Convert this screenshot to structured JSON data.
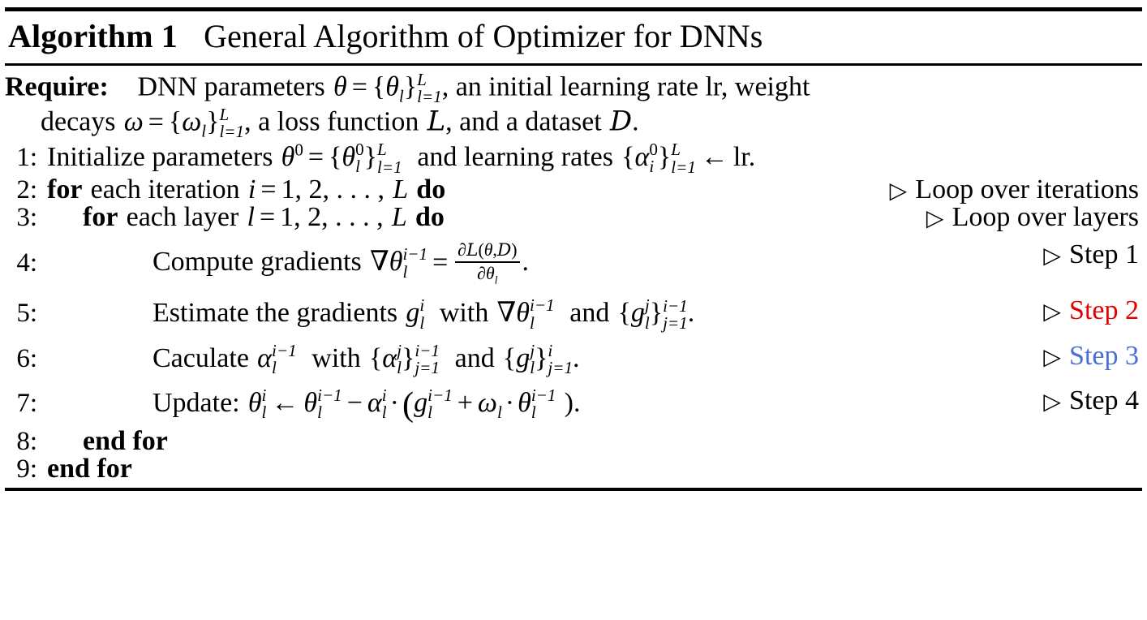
{
  "figure": {
    "label": "Algorithm 1",
    "title": "General Algorithm of Optimizer for DNNs",
    "colors": {
      "text": "#000000",
      "background": "#ffffff",
      "step2_red": "#e60000",
      "step3_blue": "#4a6fd4"
    }
  },
  "require": {
    "keyword": "Require:",
    "line1_plain": "DNN parameters",
    "line1_tail": ", an initial learning rate lr, weight",
    "line2_plain": "decays",
    "line2_tail": ", a loss function",
    "line2_tail2": ", and a dataset",
    "line2_end": ".",
    "theta": "θ",
    "omega": "ω",
    "eq": "=",
    "L": "L",
    "l_eq_1": "l=1",
    "lcal": "L",
    "dcal": "D"
  },
  "lines": [
    {
      "number": "1:",
      "indent": 0,
      "text": "Initialize parameters θ⁰ = {θ_l⁰}ᴸ_{l=1} and learning rates {α_i⁰}ᴸ_{l=1} ← lr.",
      "words": {
        "w1": "Initialize parameters",
        "w2": "and learning rates",
        "arrow": "←",
        "lr": "lr."
      },
      "comment": "",
      "comment_color": ""
    },
    {
      "number": "2:",
      "indent": 0,
      "text": "for each iteration i = 1, 2, …, L do",
      "words": {
        "kw_for": "for",
        "w1": "each iteration",
        "eq": "=",
        "seq": "1, 2, . . . ,",
        "L": "L",
        "kw_do": "do"
      },
      "comment": "Loop over iterations",
      "comment_color": "black"
    },
    {
      "number": "3:",
      "indent": 1,
      "text": "for each layer l = 1, 2, …, L do",
      "words": {
        "kw_for": "for",
        "w1": "each layer",
        "eq": "=",
        "seq": "1, 2, . . . ,",
        "L": "L",
        "kw_do": "do"
      },
      "comment": "Loop over layers",
      "comment_color": "black"
    },
    {
      "number": "4:",
      "indent": 2,
      "text": "Compute gradients ∇θ_l^{i-1} = ∂L(θ,D)/∂θ_l.",
      "words": {
        "w1": "Compute gradients",
        "nabla": "∇",
        "eq": "=",
        "partial": "∂",
        "end": "."
      },
      "comment": "Step 1",
      "comment_color": "black"
    },
    {
      "number": "5:",
      "indent": 2,
      "text": "Estimate the gradients g_l^i with ∇θ_l^{i-1} and {g_l^j}^{i-1}_{j=1}.",
      "words": {
        "w1": "Estimate the gradients",
        "w2": "with",
        "w3": "and",
        "end": "."
      },
      "comment": "Step 2",
      "comment_color": "red"
    },
    {
      "number": "6:",
      "indent": 2,
      "text": "Caculate α_l^{i-1} with {α_l^j}^{i-1}_{j=1} and {g_l^j}^i_{j=1}.",
      "words": {
        "w1": "Caculate",
        "w2": "with",
        "w3": "and",
        "end": "."
      },
      "comment": "Step 3",
      "comment_color": "blue"
    },
    {
      "number": "7:",
      "indent": 2,
      "text": "Update: θ_l^i ← θ_l^{i-1} − α_l^i · (g_l^{i-1} + ω_l · θ_l^{i-1}).",
      "words": {
        "w1": "Update:",
        "arrow": "←",
        "minus": "−",
        "cdot": "·",
        "plus": "+",
        "end": ")."
      },
      "comment": "Step 4",
      "comment_color": "black"
    },
    {
      "number": "8:",
      "indent": 1,
      "text": "end for",
      "words": {
        "kw": "end for"
      },
      "comment": "",
      "comment_color": ""
    },
    {
      "number": "9:",
      "indent": 0,
      "text": "end for",
      "words": {
        "kw": "end for"
      },
      "comment": "",
      "comment_color": ""
    }
  ],
  "symbols": {
    "triangle": "▷",
    "theta": "θ",
    "alpha": "α",
    "omega": "ω",
    "g": "g",
    "i": "i",
    "j": "j",
    "l": "l",
    "L": "L",
    "zero": "0",
    "one": "1",
    "i_minus_1": "i−1",
    "j_eq_1": "j=1",
    "l_eq_1": "l=1"
  }
}
